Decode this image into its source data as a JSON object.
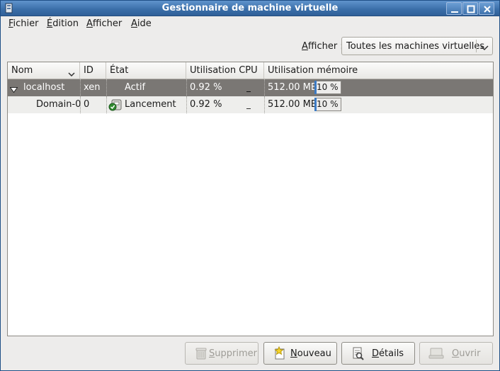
{
  "window": {
    "title": "Gestionnaire de machine virtuelle",
    "icon": "virt-manager-app-icon"
  },
  "menubar": {
    "items": [
      {
        "label": "Fichier"
      },
      {
        "label": "Édition"
      },
      {
        "label": "Afficher"
      },
      {
        "label": "Aide"
      }
    ]
  },
  "filter": {
    "label": "Afficher :",
    "selected": "Toutes les machines virtuelles"
  },
  "table": {
    "columns": [
      "Nom",
      "ID",
      "État",
      "Utilisation CPU",
      "Utilisation mémoire"
    ],
    "rows": [
      {
        "name": "localhost",
        "id": "xen",
        "state": "Actif",
        "cpu": "0.92 %",
        "cpu_graph": "_",
        "memory": "512.00 MB",
        "memory_pct": "10 %",
        "memory_fraction": 0.1,
        "expanded": true,
        "selected": true
      },
      {
        "name": "Domain-0",
        "id": "0",
        "state": "Lancement",
        "state_icon": "running-vm-icon",
        "cpu": "0.92 %",
        "cpu_graph": "_",
        "memory": "512.00 MB",
        "memory_pct": "10 %",
        "memory_fraction": 0.1,
        "selected": false
      }
    ]
  },
  "buttons": {
    "delete": {
      "label": "Supprimer",
      "enabled": false,
      "icon": "trash-icon"
    },
    "new": {
      "label": "Nouveau",
      "enabled": true,
      "icon": "new-star-icon"
    },
    "details": {
      "label": "Détails",
      "enabled": true,
      "icon": "details-icon"
    },
    "open": {
      "label": "Ouvrir",
      "enabled": false,
      "icon": "console-icon"
    }
  },
  "colors": {
    "titlebar": "#3a6ea8",
    "selection": "#7a7774",
    "memory_bar": "#3c7bc4"
  }
}
